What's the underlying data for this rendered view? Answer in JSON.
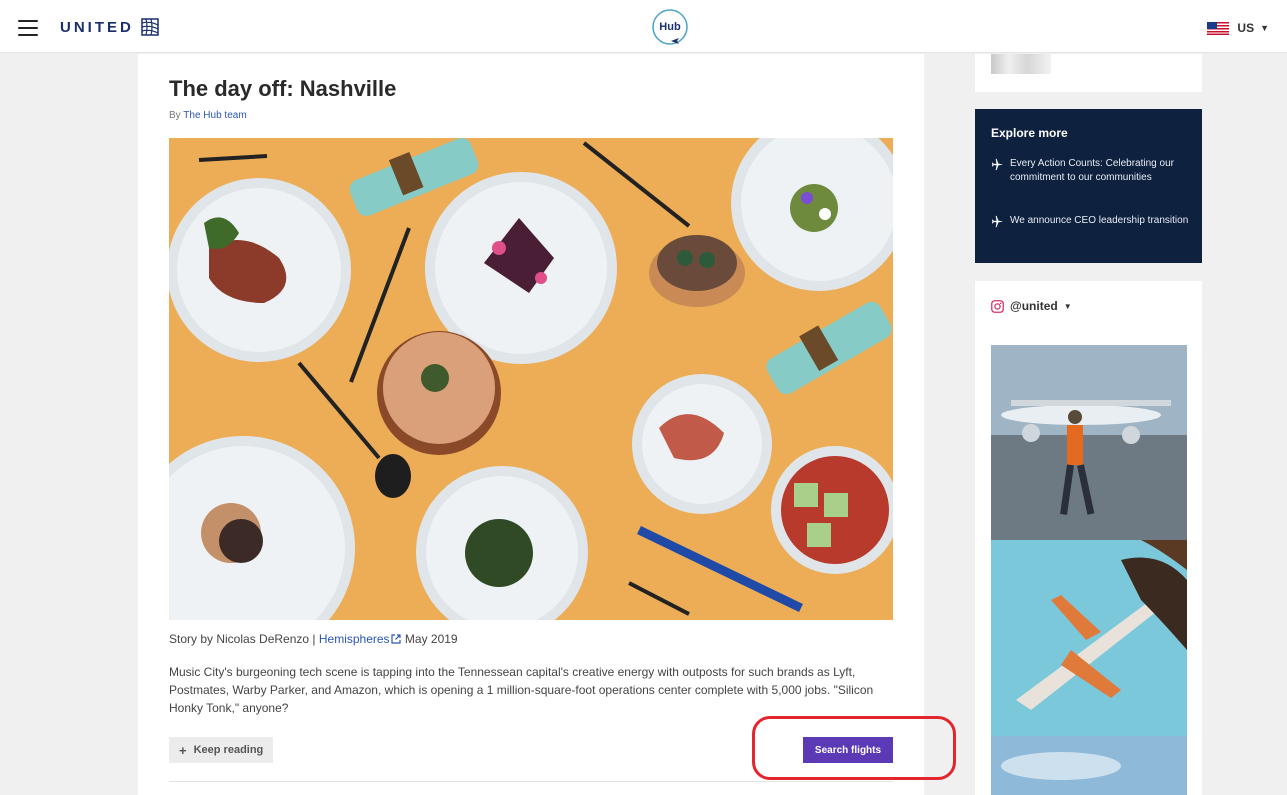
{
  "header": {
    "brand": "UNITED",
    "hub_logo_text": "Hub",
    "locale": "US"
  },
  "article": {
    "title": "The day off: Nashville",
    "byline_prefix": "By",
    "byline_author": "The Hub team",
    "credit_prefix": "Story by Nicolas DeRenzo |",
    "credit_link": "Hemispheres",
    "credit_date": "May 2019",
    "body": "Music City's burgeoning tech scene is tapping into the Tennessean capital's creative energy with outposts for such brands as Lyft, Postmates, Warby Parker, and Amazon, which is opening a 1 million-square-foot operations center complete with 5,000 jobs. \"Silicon Honky Tonk,\" anyone?",
    "keep_reading_label": "Keep reading",
    "search_flights_label": "Search flights"
  },
  "sidebar": {
    "explore_title": "Explore more",
    "explore_items": [
      "Every Action Counts: Celebrating our commitment to our communities",
      "We announce CEO leadership transition"
    ],
    "instagram_handle": "@united"
  },
  "colors": {
    "brand_navy": "#1a2f6b",
    "explore_bg": "#0e2240",
    "search_button": "#5c3ab5",
    "link": "#2a56b5",
    "annotation_outline": "#e3262d"
  },
  "icons": [
    "hamburger-menu-icon",
    "united-globe-icon",
    "hub-logo",
    "us-flag-icon",
    "chevron-down-icon",
    "external-link-icon",
    "plus-icon",
    "airplane-icon",
    "instagram-icon"
  ]
}
